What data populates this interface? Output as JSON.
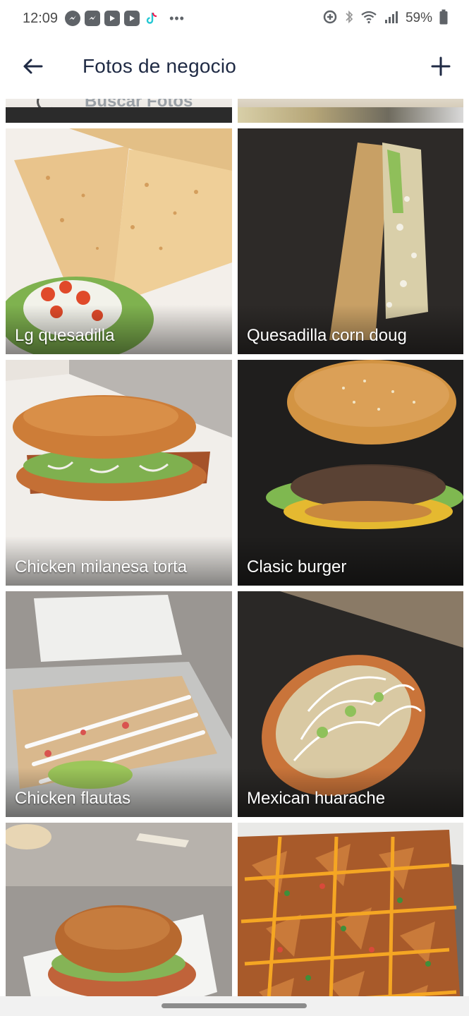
{
  "status_bar": {
    "time": "12:09",
    "battery": "59%",
    "notification_icons": [
      "messenger-icon",
      "messenger-icon",
      "youtube-icon",
      "youtube-icon",
      "tiktok-icon"
    ],
    "more": "•••"
  },
  "app_bar": {
    "title": "Fotos de negocio"
  },
  "partial_row": {
    "search_hint": "Buscar Fotos"
  },
  "photos": [
    {
      "caption": "Lg quesadilla"
    },
    {
      "caption": "Quesadilla corn doug"
    },
    {
      "caption": "Chicken milanesa torta"
    },
    {
      "caption": "Clasic burger"
    },
    {
      "caption": "Chicken flautas"
    },
    {
      "caption": "Mexican huarache"
    },
    {
      "caption": ""
    },
    {
      "caption": ""
    }
  ],
  "colors": {
    "title": "#1f2a44",
    "caption": "#ffffff",
    "accent": "#1f2a44"
  }
}
